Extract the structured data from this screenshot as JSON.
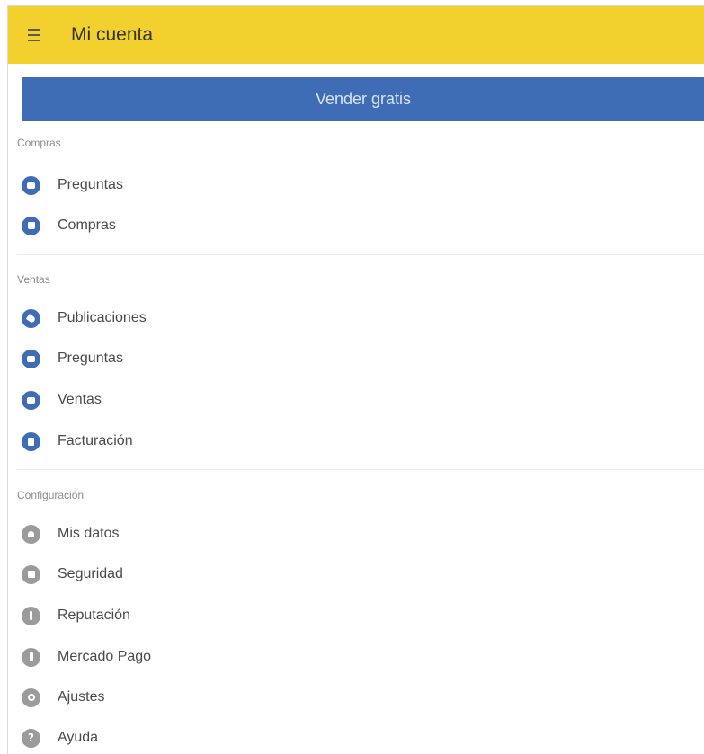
{
  "header": {
    "title": "Mi cuenta",
    "menu_icon": "hamburger-menu-icon",
    "background_color": "#f2d02e"
  },
  "sell_button": {
    "label": "Vender gratis",
    "color": "#3f6db5"
  },
  "sections": {
    "compras": {
      "title": "Compras",
      "items": [
        {
          "label": "Preguntas",
          "icon": "chat-icon",
          "color": "#3f6db5"
        },
        {
          "label": "Compras",
          "icon": "shopping-bag-icon",
          "color": "#3f6db5"
        }
      ]
    },
    "ventas": {
      "title": "Ventas",
      "items": [
        {
          "label": "Publicaciones",
          "icon": "tag-icon",
          "color": "#3f6db5"
        },
        {
          "label": "Preguntas",
          "icon": "chat-icon",
          "color": "#3f6db5"
        },
        {
          "label": "Ventas",
          "icon": "chat-icon",
          "color": "#3f6db5"
        },
        {
          "label": "Facturación",
          "icon": "document-icon",
          "color": "#3f6db5"
        }
      ]
    },
    "configuracion": {
      "title": "Configuración",
      "items": [
        {
          "label": "Mis datos",
          "icon": "person-icon",
          "color": "#9b9b9b"
        },
        {
          "label": "Seguridad",
          "icon": "lock-icon",
          "color": "#9b9b9b"
        },
        {
          "label": "Reputación",
          "icon": "reputation-icon",
          "color": "#9b9b9b"
        },
        {
          "label": "Mercado Pago",
          "icon": "money-icon",
          "color": "#9b9b9b"
        },
        {
          "label": "Ajustes",
          "icon": "gear-icon",
          "color": "#9b9b9b"
        },
        {
          "label": "Ayuda",
          "icon": "help-icon",
          "color": "#9b9b9b"
        }
      ]
    }
  }
}
